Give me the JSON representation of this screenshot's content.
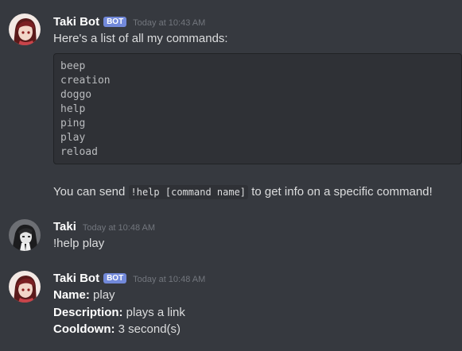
{
  "messages": [
    {
      "username": "Taki Bot",
      "bot_tag": "BOT",
      "timestamp": "Today at 10:43 AM",
      "intro": "Here's a list of all my commands:",
      "commands": [
        "beep",
        "creation",
        "doggo",
        "help",
        "ping",
        "play",
        "reload"
      ],
      "footer_before": "You can send ",
      "footer_code": "!help [command name]",
      "footer_after": " to get info on a specific command!"
    },
    {
      "username": "Taki",
      "timestamp": "Today at 10:48 AM",
      "text": "!help play"
    },
    {
      "username": "Taki Bot",
      "bot_tag": "BOT",
      "timestamp": "Today at 10:48 AM",
      "fields": [
        {
          "label": "Name:",
          "value": " play"
        },
        {
          "label": "Description:",
          "value": " plays a link"
        },
        {
          "label": "Cooldown:",
          "value": " 3 second(s)"
        }
      ]
    }
  ],
  "colors": {
    "background": "#36393f",
    "bot_tag": "#7289da",
    "codeblock": "#2f3136"
  },
  "icons": {
    "bot_avatar": "bot-avatar-icon",
    "user_avatar": "user-avatar-icon"
  }
}
